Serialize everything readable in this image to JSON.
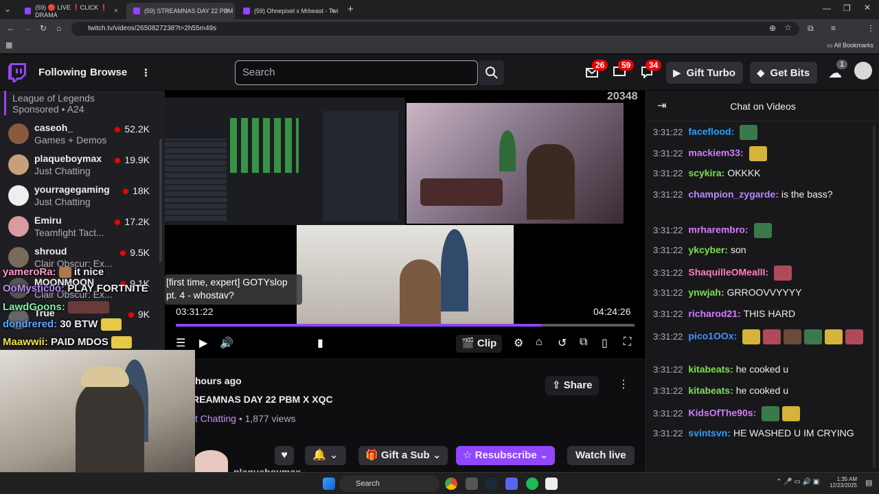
{
  "browser": {
    "tabs": [
      {
        "title": "(59) 🔴 LIVE ❗CLICK ❗ DRAMA"
      },
      {
        "title": "(59) STREAMNAS DAY 22 PBM"
      },
      {
        "title": "(59) Ohnepixel x Mrbeast - Twi"
      }
    ],
    "url": "twitch.tv/videos/2650827238?t=2h55m49s",
    "bookmarks_label": "All Bookmarks",
    "new_tab": "+"
  },
  "nav": {
    "following": "Following",
    "browse": "Browse",
    "more": "⋮",
    "search_placeholder": "Search",
    "badges": {
      "inbox": "26",
      "whispers": "59",
      "notifications": "34"
    },
    "gift_turbo": "Gift Turbo",
    "get_bits": "Get Bits",
    "bits_count": "1"
  },
  "sidebar": {
    "sponsored_title": "League of Legends",
    "sponsored_label": "Sponsored • A24",
    "channels": [
      {
        "name": "caseoh_",
        "game": "Games + Demos",
        "viewers": "52.2K"
      },
      {
        "name": "plaqueboymax",
        "game": "Just Chatting",
        "viewers": "19.9K"
      },
      {
        "name": "yourragegaming",
        "game": "Just Chatting",
        "viewers": "18K"
      },
      {
        "name": "Emiru",
        "game": "Teamfight Tact...",
        "viewers": "17.2K"
      },
      {
        "name": "shroud",
        "game": "Clair Obscur: Ex...",
        "viewers": "9.5K"
      },
      {
        "name": "MOONMOON",
        "game": "Clair Obscur: Ex...",
        "viewers": "9.1K"
      },
      {
        "name": "True",
        "game": "",
        "viewers": "9K"
      }
    ]
  },
  "player": {
    "viewer_count": "20348",
    "tooltip": "[first time, expert] GOTYslop pt. 4 - whostav?",
    "current_time": "03:31:22",
    "duration": "04:24:26",
    "progress": 0.797,
    "clip_label": "Clip"
  },
  "video_info": {
    "age": "hours ago",
    "title": "REAMNAS DAY 22 PBM X XQC",
    "category": "t Chatting",
    "views": "• 1,877 views",
    "share": "Share",
    "gift_sub": "Gift a Sub",
    "resubscribe": "Resubscribe",
    "watch_live": "Watch live",
    "channel": "plaqueboymax"
  },
  "overlay_chat": [
    {
      "user": "yameroRa:",
      "text": "it nice",
      "color": "#ff9acb"
    },
    {
      "user": "OoMystic0o:",
      "text": "PLAY FORTNITE",
      "color": "#b98bff"
    },
    {
      "user": "LawdGoons:",
      "text": "",
      "color": "#7df5a0"
    },
    {
      "user": "dondrered:",
      "text": "30 BTW",
      "color": "#5aa8ff"
    },
    {
      "user": "Maawwii:",
      "text": "PAID MDOS",
      "color": "#f2e14a"
    }
  ],
  "chat": {
    "header": "Chat on Videos",
    "collapse_icon": "collapse-right-icon",
    "messages": [
      {
        "time": "3:31:22",
        "user": "faceflood:",
        "text": "",
        "color": "#2ea0ff",
        "emotes": 1
      },
      {
        "time": "3:31:22",
        "user": "mackiem33:",
        "text": "",
        "color": "#d37bff",
        "emotes": 1
      },
      {
        "time": "3:31:22",
        "user": "scykira:",
        "text": "OKKKK",
        "color": "#7ce04e",
        "emotes": 0
      },
      {
        "time": "3:31:22",
        "user": "champion_zygarde:",
        "text": "is the bass?",
        "color": "#b48bff",
        "emotes": 0
      },
      {
        "time": "3:31:22",
        "user": "mrharembro:",
        "text": "",
        "color": "#d37bff",
        "emotes": 1
      },
      {
        "time": "3:31:22",
        "user": "ykcyber:",
        "text": "son",
        "color": "#7ce04e",
        "emotes": 0
      },
      {
        "time": "3:31:22",
        "user": "ShaquilleOMeallI:",
        "text": "",
        "color": "#ff7fbf",
        "emotes": 1
      },
      {
        "time": "3:31:22",
        "user": "ynwjah:",
        "text": "GRROOVVYYYY",
        "color": "#7ce04e",
        "emotes": 0
      },
      {
        "time": "3:31:22",
        "user": "richarod21:",
        "text": "THIS HARD",
        "color": "#d37bff",
        "emotes": 0
      },
      {
        "time": "3:31:22",
        "user": "pico1OOx:",
        "text": "",
        "color": "#4a90ff",
        "emotes": 6
      },
      {
        "time": "3:31:22",
        "user": "kitabeats:",
        "text": "he cooked u",
        "color": "#7ce04e",
        "emotes": 0
      },
      {
        "time": "3:31:22",
        "user": "kitabeats:",
        "text": "he cooked u",
        "color": "#7ce04e",
        "emotes": 0
      },
      {
        "time": "3:31:22",
        "user": "KidsOfThe90s:",
        "text": "",
        "color": "#d37bff",
        "emotes": 2
      },
      {
        "time": "3:31:22",
        "user": "svintsvn:",
        "text": "HE WASHED U IM CRYING",
        "color": "#2ea0ff",
        "emotes": 0
      }
    ]
  },
  "taskbar": {
    "search": "Search",
    "clock_time": "1:35 AM",
    "clock_date": "12/23/2025"
  },
  "colors": {
    "twitch_purple": "#9146ff",
    "live_red": "#eb0400"
  }
}
